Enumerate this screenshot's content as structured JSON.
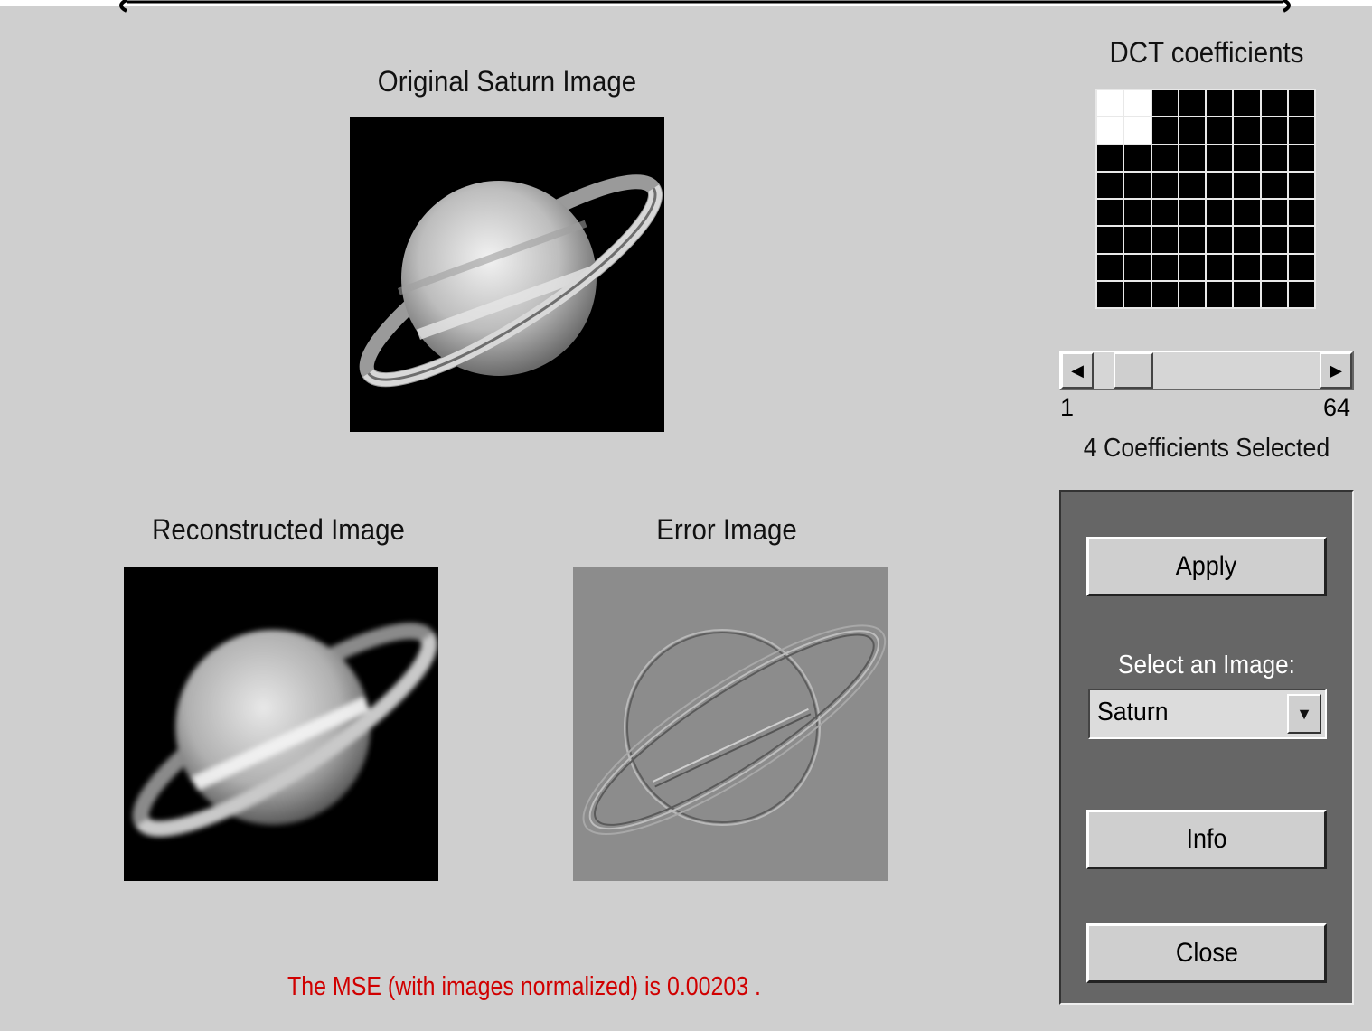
{
  "titles": {
    "original": "Original Saturn Image",
    "reconstructed": "Reconstructed Image",
    "error": "Error Image",
    "dct": "DCT coefficients"
  },
  "dct": {
    "grid_size": 8,
    "selected": [
      [
        0,
        0
      ],
      [
        0,
        1
      ],
      [
        1,
        0
      ],
      [
        1,
        1
      ]
    ]
  },
  "slider": {
    "min_label": "1",
    "max_label": "64",
    "value": 4,
    "min": 1,
    "max": 64,
    "status": "4 Coefficients Selected"
  },
  "panel": {
    "apply_label": "Apply",
    "select_label": "Select an Image:",
    "select_value": "Saturn",
    "info_label": "Info",
    "close_label": "Close"
  },
  "mse_text": "The MSE (with images normalized) is 0.00203 .",
  "colors": {
    "background": "#cfcfcf",
    "panel": "#666666",
    "mse_text": "#d00000"
  },
  "icons": {
    "scroll_left": "triangle-left-icon",
    "scroll_right": "triangle-right-icon",
    "dropdown": "triangle-down-icon"
  }
}
